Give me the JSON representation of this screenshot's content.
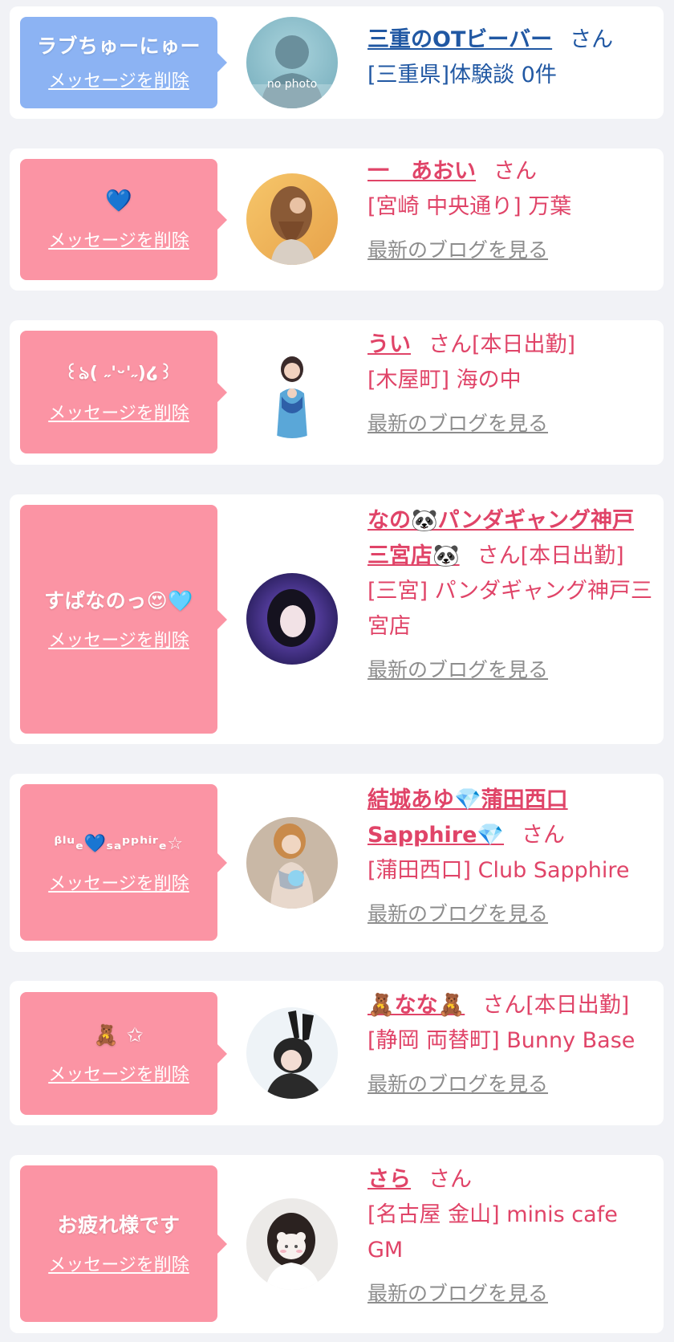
{
  "colors": {
    "page_bg": "#f1f2f6",
    "card_bg": "#ffffff",
    "bubble_blue": "#8cb3f3",
    "bubble_pink": "#fb94a4",
    "name_pink": "#e04468",
    "name_blue": "#2158a3",
    "blog_gray": "#8d8d8d"
  },
  "delete_label": "メッセージを削除",
  "blog_label": "最新のブログを見る",
  "san_label": "さん",
  "entries": [
    {
      "message": "ラブちゅーにゅー",
      "avatar": "no-photo-silhouette",
      "avatar_text": "no photo",
      "name": "三重のOTビーバー",
      "status": "",
      "detail": "[三重県]体験談 0件"
    },
    {
      "message": "💙",
      "avatar": "woman-braided-hair",
      "name": "一　あおい",
      "status": "",
      "detail": "[宮崎 中央通り] 万葉"
    },
    {
      "message": "꒰ঌ( ˶'ᵕ'˶)໒꒱",
      "avatar": "woman-idol-costume",
      "name": "うい",
      "status": "[本日出勤]",
      "detail": "[木屋町] 海の中"
    },
    {
      "message": "すぱなのっ😍🩵",
      "avatar": "woman-purple-light",
      "name": "なの🐼パンダギャング神戸三宮店🐼",
      "status": "[本日出勤]",
      "detail": "[三宮] パンダギャング神戸三宮店"
    },
    {
      "message": "ᵝˡᵘₑ💙ₛₐᵖᵖʰⁱʳₑ☆",
      "avatar": "woman-silver-outfit",
      "name": "結城あゆ💎蒲田西口Sapphire💎",
      "status": "",
      "detail": "[蒲田西口] Club Sapphire"
    },
    {
      "message": "🧸 ✩",
      "avatar": "woman-bunny-ears",
      "name": "🧸なな🧸",
      "status": "[本日出勤]",
      "detail": "[静岡 両替町] Bunny Base"
    },
    {
      "message": "お疲れ様です",
      "avatar": "woman-cat-mask",
      "name": "さら",
      "status": "",
      "detail": "[名古屋 金山] minis cafe GM"
    }
  ]
}
